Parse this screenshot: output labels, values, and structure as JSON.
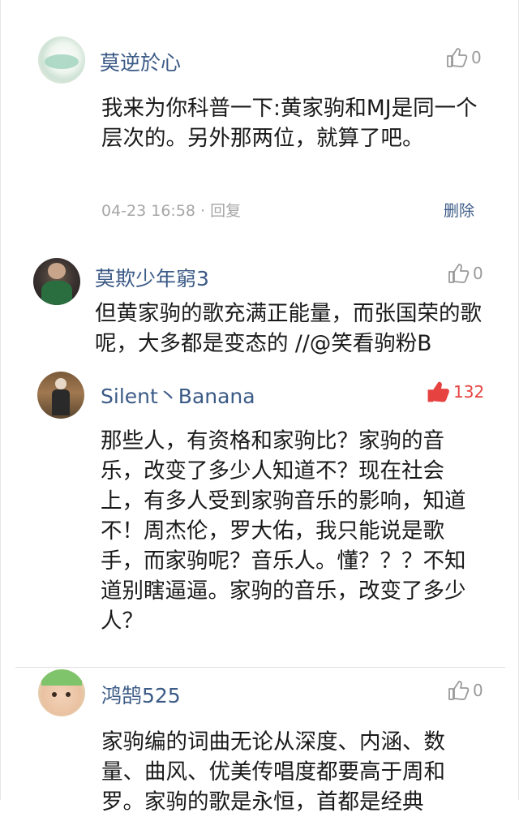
{
  "comments": [
    {
      "user": "莫逆於心",
      "likes": "0",
      "text": "我来为你科普一下:黄家驹和MJ是同一个层次的。另外那两位，就算了吧。",
      "meta": "04-23 16:58 · 回复",
      "delete_label": "删除"
    },
    {
      "user": "莫欺少年窮3",
      "likes": "0",
      "text": "但黄家驹的歌充满正能量，而张国荣的歌呢，大多都是变态的 //@笑看驹粉B"
    },
    {
      "user": "Silent丶Banana",
      "likes": "132",
      "text": "那些人，有资格和家驹比？家驹的音乐，改变了多少人知道不？现在社会上，有多人受到家驹音乐的影响，知道不！周杰伦，罗大佑，我只能说是歌手，而家驹呢？音乐人。懂？？？不知道别瞎逼逼。家驹的音乐，改变了多少人？"
    },
    {
      "user": "鸿鹄525",
      "likes": "0",
      "text": "家驹编的词曲无论从深度、内涵、数量、曲风、优美传唱度都要高于周和罗。家驹的歌是永恒，首都是经典"
    }
  ],
  "colors": {
    "name": "#3b5a86",
    "like_hot": "#e64340",
    "like": "#9a9a9a"
  },
  "icons": {
    "like": "thumb-up-icon"
  }
}
